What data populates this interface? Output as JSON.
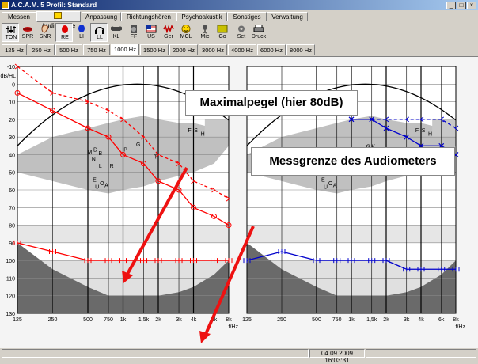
{
  "window": {
    "title": "A.C.A.M. 5 Profil: Standard",
    "controls": [
      "_",
      "□",
      "×"
    ]
  },
  "menu_tabs": [
    {
      "label": "Messen",
      "active": false
    },
    {
      "label": "Audiometrie",
      "active": true
    },
    {
      "label": "Anpassung",
      "active": false
    },
    {
      "label": "Richtungshören",
      "active": false
    },
    {
      "label": "Psychoakustik",
      "active": false
    },
    {
      "label": "Sonstiges",
      "active": false
    },
    {
      "label": "Verwaltung",
      "active": false
    }
  ],
  "toolbar": [
    {
      "label": "TON",
      "icon": "sliders-icon",
      "selected": true
    },
    {
      "label": "SPR",
      "icon": "lips-icon",
      "selected": false
    },
    {
      "label": "SNR",
      "icon": "ear-icon",
      "selected": false
    },
    {
      "label": "RE",
      "icon": "red-ear-marker-icon",
      "selected": true
    },
    {
      "label": "LI",
      "icon": "blue-ear-marker-icon",
      "selected": false
    },
    {
      "label": "LL",
      "icon": "headphones-icon",
      "selected": true
    },
    {
      "label": "KL",
      "icon": "bone-icon",
      "selected": false
    },
    {
      "label": "FF",
      "icon": "speaker-icon",
      "selected": false
    },
    {
      "label": "US",
      "icon": "flag-icon",
      "selected": false
    },
    {
      "label": "Ger",
      "icon": "noise-icon",
      "selected": false
    },
    {
      "label": "MCL",
      "icon": "smiley-icon",
      "selected": false
    },
    {
      "label": "Mic",
      "icon": "microphone-icon",
      "selected": false
    },
    {
      "label": "Go",
      "icon": "go-icon",
      "selected": false
    },
    {
      "label": "Set",
      "icon": "gear-icon",
      "selected": false
    },
    {
      "label": "Druck",
      "icon": "printer-icon",
      "selected": false
    }
  ],
  "freq_tabs": [
    {
      "label": "125 Hz",
      "active": false
    },
    {
      "label": "250 Hz",
      "active": false
    },
    {
      "label": "500 Hz",
      "active": false
    },
    {
      "label": "750 Hz",
      "active": false
    },
    {
      "label": "1000 Hz",
      "active": true
    },
    {
      "label": "1500 Hz",
      "active": false
    },
    {
      "label": "2000 Hz",
      "active": false
    },
    {
      "label": "3000 Hz",
      "active": false
    },
    {
      "label": "4000 Hz",
      "active": false
    },
    {
      "label": "6000 Hz",
      "active": false
    },
    {
      "label": "8000 Hz",
      "active": false
    }
  ],
  "callouts": {
    "max_level": "Maximalpegel (hier 80dB)",
    "limit": "Messgrenze des Audiometers"
  },
  "status": {
    "datetime": "04.09.2009 16:03:31"
  },
  "colors": {
    "right_ear": "#ff0000",
    "left_ear": "#0000cc",
    "arrow": "#ee1111"
  },
  "chart_data": [
    {
      "type": "line",
      "ear": "right",
      "ylabel": "dB/HL",
      "xlabel": "f/Hz",
      "y_ticks": [
        "-10",
        "0",
        "10",
        "20",
        "30",
        "40",
        "50",
        "60",
        "70",
        "80",
        "90",
        "100",
        "110",
        "120",
        "130"
      ],
      "x_ticks": [
        "125",
        "250",
        "500",
        "750",
        "1k",
        "1,5k",
        "2k",
        "3k",
        "4k",
        "6k",
        "8k"
      ],
      "ylim": [
        -10,
        130
      ],
      "y_inverted": true,
      "speech_letters": [
        {
          "t": "M",
          "f": 520,
          "db": 38
        },
        {
          "t": "D",
          "f": 580,
          "db": 37
        },
        {
          "t": "B",
          "f": 640,
          "db": 39
        },
        {
          "t": "N",
          "f": 560,
          "db": 42
        },
        {
          "t": "L",
          "f": 640,
          "db": 46
        },
        {
          "t": "R",
          "f": 800,
          "db": 46
        },
        {
          "t": "E",
          "f": 570,
          "db": 54
        },
        {
          "t": "U",
          "f": 600,
          "db": 58
        },
        {
          "t": "O",
          "f": 660,
          "db": 56
        },
        {
          "t": "A",
          "f": 720,
          "db": 57
        },
        {
          "t": "P",
          "f": 1050,
          "db": 37
        },
        {
          "t": "G",
          "f": 1350,
          "db": 34
        },
        {
          "t": "T",
          "f": 1900,
          "db": 41
        },
        {
          "t": "F",
          "f": 3700,
          "db": 26
        },
        {
          "t": "S",
          "f": 4200,
          "db": 26
        },
        {
          "t": "H",
          "f": 4800,
          "db": 28
        }
      ],
      "series": [
        {
          "name": "",
          "style": "solid",
          "marker": "circle",
          "x": [
            125,
            250,
            500,
            750,
            1000,
            1500,
            2000,
            3000,
            4000,
            6000,
            8000
          ],
          "y": [
            5,
            15,
            25,
            30,
            40,
            45,
            55,
            60,
            70,
            75,
            80
          ]
        },
        {
          "name": "",
          "style": "dashed",
          "marker": "arrow",
          "x": [
            125,
            250,
            500,
            750,
            1000,
            1500,
            2000,
            3000,
            4000,
            6000,
            8000
          ],
          "y": [
            -10,
            5,
            10,
            15,
            20,
            30,
            40,
            45,
            55,
            60,
            65
          ]
        },
        {
          "name": "",
          "style": "solid",
          "marker": "limit",
          "x": [
            125,
            250,
            500,
            750,
            1000,
            1500,
            2000,
            3000,
            4000,
            6000,
            8000
          ],
          "y": [
            90,
            95,
            100,
            100,
            100,
            100,
            100,
            100,
            100,
            100,
            100
          ]
        }
      ]
    },
    {
      "type": "line",
      "ear": "left",
      "xlabel": "f/Hz",
      "x_ticks": [
        "125",
        "250",
        "500",
        "750",
        "1k",
        "1,5k",
        "2k",
        "3k",
        "4k",
        "6k",
        "8k"
      ],
      "ylim": [
        -10,
        130
      ],
      "y_inverted": true,
      "speech_letters": [
        {
          "t": "M",
          "f": 520,
          "db": 38
        },
        {
          "t": "D",
          "f": 580,
          "db": 37
        },
        {
          "t": "B",
          "f": 640,
          "db": 39
        },
        {
          "t": "N",
          "f": 560,
          "db": 42
        },
        {
          "t": "L",
          "f": 640,
          "db": 46
        },
        {
          "t": "R",
          "f": 800,
          "db": 46
        },
        {
          "t": "E",
          "f": 570,
          "db": 54
        },
        {
          "t": "U",
          "f": 600,
          "db": 58
        },
        {
          "t": "O",
          "f": 660,
          "db": 56
        },
        {
          "t": "A",
          "f": 720,
          "db": 57
        },
        {
          "t": "P",
          "f": 1050,
          "db": 37
        },
        {
          "t": "G",
          "f": 1400,
          "db": 35
        },
        {
          "t": "K",
          "f": 1550,
          "db": 35
        },
        {
          "t": "T",
          "f": 1900,
          "db": 41
        },
        {
          "t": "F",
          "f": 3700,
          "db": 26
        },
        {
          "t": "S",
          "f": 4200,
          "db": 26
        },
        {
          "t": "H",
          "f": 4800,
          "db": 28
        }
      ],
      "series": [
        {
          "name": "",
          "style": "solid",
          "marker": "cross",
          "x": [
            1000,
            1500,
            2000,
            3000,
            4000,
            6000,
            8000
          ],
          "y": [
            20,
            20,
            25,
            30,
            35,
            35,
            40
          ]
        },
        {
          "name": "",
          "style": "dashed",
          "marker": "arrow",
          "x": [
            1500,
            2000,
            3000,
            4000,
            6000,
            8000
          ],
          "y": [
            20,
            20,
            20,
            20,
            20,
            25
          ]
        },
        {
          "name": "",
          "style": "solid",
          "marker": "limit",
          "x": [
            125,
            250,
            500,
            750,
            1000,
            1500,
            2000,
            3000,
            4000,
            6000,
            8000
          ],
          "y": [
            100,
            95,
            100,
            100,
            100,
            100,
            100,
            105,
            105,
            105,
            105
          ]
        }
      ]
    }
  ]
}
